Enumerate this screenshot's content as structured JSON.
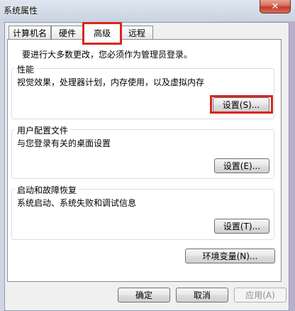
{
  "window": {
    "title": "系统属性",
    "close_symbol": "✕"
  },
  "tabs": [
    {
      "label": "计算机名"
    },
    {
      "label": "硬件"
    },
    {
      "label": "高级"
    },
    {
      "label": "远程"
    }
  ],
  "active_tab": "高级",
  "panel": {
    "admin_note": "要进行大多数更改，您必须作为管理员登录。",
    "performance": {
      "title": "性能",
      "description": "视觉效果，处理器计划，内存使用，以及虚拟内存",
      "button": "设置(S)..."
    },
    "user_profiles": {
      "title": "用户配置文件",
      "description": "与您登录有关的桌面设置",
      "button": "设置(E)..."
    },
    "startup_recovery": {
      "title": "启动和故障恢复",
      "description": "系统启动、系统失败和调试信息",
      "button": "设置(T)..."
    },
    "env_button": "环境变量(N)..."
  },
  "footer": {
    "ok": "确定",
    "cancel": "取消",
    "apply": "应用(A)"
  }
}
